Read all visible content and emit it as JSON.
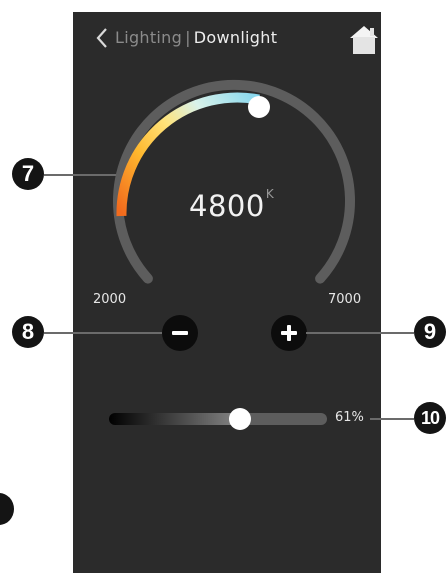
{
  "header": {
    "back_icon": "chevron-left-icon",
    "parent": "Lighting",
    "separator": "|",
    "current": "Downlight",
    "home_icon": "home-icon"
  },
  "color_temperature": {
    "value": "4800",
    "unit": "K",
    "min_label": "2000",
    "max_label": "7000",
    "min": 2000,
    "max": 7000,
    "current": 4800,
    "arc_colors": [
      "#f26b1d",
      "#ffc93a",
      "#ffe680",
      "#d7f3ee",
      "#7fd6ee"
    ]
  },
  "controls": {
    "decrease_icon": "minus-icon",
    "increase_icon": "plus-icon"
  },
  "brightness": {
    "value_label": "61%",
    "fraction": 0.61
  },
  "callouts": {
    "c7": "7",
    "c8": "8",
    "c9": "9",
    "c10": "10"
  },
  "colors": {
    "screen_bg": "#2b2b2b",
    "track": "#5d5d5d",
    "button_bg": "#0c0c0c"
  }
}
